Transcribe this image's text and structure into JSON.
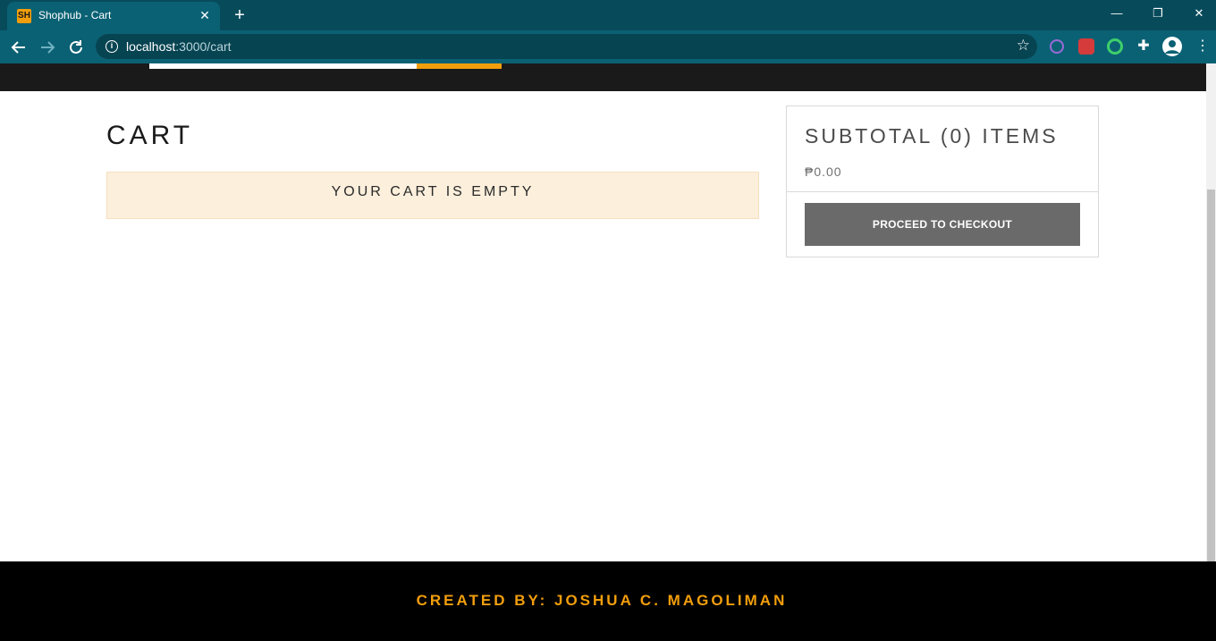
{
  "browser": {
    "tab_title": "Shophub - Cart",
    "favicon_text": "SH",
    "url_host": "localhost",
    "url_path": ":3000/cart",
    "icons": {
      "back": "arrow-left-icon",
      "forward": "arrow-right-icon",
      "reload": "reload-icon",
      "bookmark": "star-icon",
      "extensions": "puzzle-icon",
      "profile": "avatar-icon",
      "menu": "kebab-icon"
    }
  },
  "cart": {
    "title": "CART",
    "empty_message": "YOUR CART IS EMPTY"
  },
  "summary": {
    "title": "SUBTOTAL (0) ITEMS",
    "price": "₱0.00",
    "checkout_label": "PROCEED TO CHECKOUT"
  },
  "footer": {
    "text": "CREATED BY: JOSHUA C. MAGOLIMAN"
  },
  "colors": {
    "accent": "#f29e0c",
    "browser_frame": "#074b5b",
    "alert_bg": "#fcefdc",
    "button_bg": "#6a6a6a"
  }
}
